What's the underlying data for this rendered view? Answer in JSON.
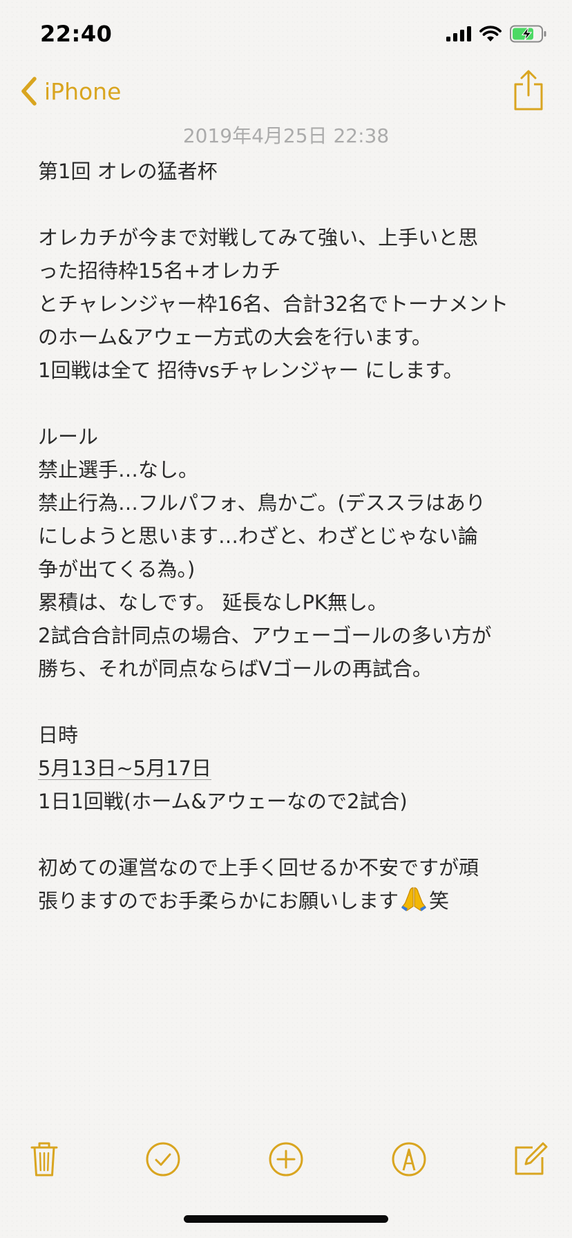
{
  "status_bar": {
    "time": "22:40"
  },
  "nav": {
    "back_label": "iPhone"
  },
  "note": {
    "date": "2019年4月25日 22:38",
    "lines": [
      "第1回 オレの猛者杯",
      "",
      "オレカチが今まで対戦してみて強い、上手いと思",
      "った招待枠15名+オレカチ",
      "とチャレンジャー枠16名、合計32名でトーナメント",
      "のホーム&アウェー方式の大会を行います。",
      "1回戦は全て 招待vsチャレンジャー にします。",
      "",
      "ルール",
      "禁止選手…なし。",
      "禁止行為…フルパフォ、鳥かご。(デススラはあり",
      "にしようと思います…わざと、わざとじゃない論",
      "争が出てくる為。)",
      "累積は、なしです。 延長なしPK無し。",
      "2試合合計同点の場合、アウェーゴールの多い方が",
      "勝ち、それが同点ならばVゴールの再試合。",
      "",
      "日時",
      "5月13日~5月17日",
      "1日1回戦(ホーム&アウェーなので2試合)",
      "",
      "初めての運営なので上手く回せるか不安ですが頑"
    ],
    "last_line_before": "張りますのでお手柔らかにお願いします",
    "last_line_after": "笑",
    "last_line_emoji": "folded-hands-icon"
  },
  "toolbar": {
    "icons": [
      "trash-icon",
      "checklist-icon",
      "add-icon",
      "markup-pen-icon",
      "compose-icon"
    ]
  },
  "colors": {
    "accent": "#d9a520",
    "text": "#2b2b2b",
    "date": "#ababab",
    "background": "#f5f4f2"
  }
}
